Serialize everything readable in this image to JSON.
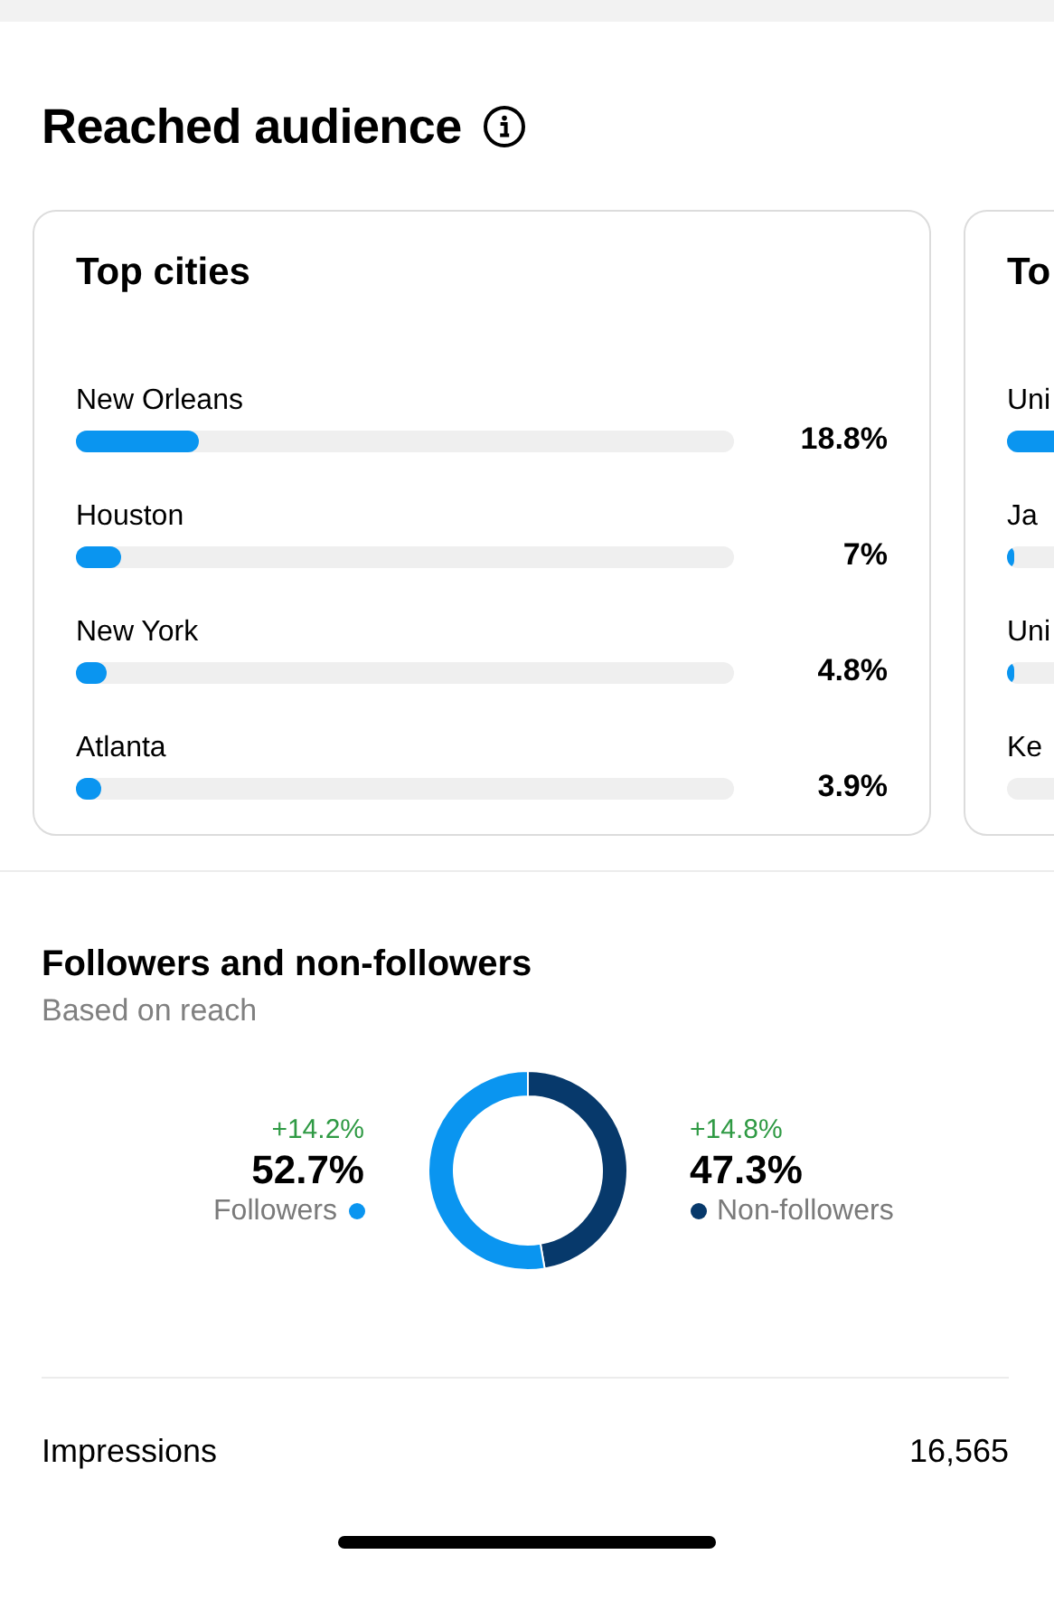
{
  "section": {
    "title": "Reached audience"
  },
  "cards": [
    {
      "title": "Top cities",
      "rows": [
        {
          "label": "New Orleans",
          "level": 0.188,
          "value": "18.8%"
        },
        {
          "label": "Houston",
          "level": 0.07,
          "value": "7%"
        },
        {
          "label": "New York",
          "level": 0.048,
          "value": "4.8%"
        },
        {
          "label": "Atlanta",
          "level": 0.039,
          "value": "3.9%"
        }
      ]
    },
    {
      "title": "To",
      "rows": [
        {
          "label": "Uni",
          "level": 0.6
        },
        {
          "label": "Ja",
          "level": 0.01
        },
        {
          "label": "Uni",
          "level": 0.01
        },
        {
          "label": "Ke"
        }
      ]
    }
  ],
  "followers": {
    "title": "Followers and non-followers",
    "subtitle": "Based on reach",
    "legend": [
      {
        "change": "+14.2%",
        "value": "52.7%",
        "color": "#0a95f0"
      },
      {
        "change": "+14.8%",
        "value": "47.3%",
        "color": "#07396b"
      }
    ],
    "chart_data": {
      "type": "donut",
      "categories": [
        "Followers",
        "Non-followers"
      ],
      "series": [
        {
          "values": [
            52.7,
            47.3
          ]
        }
      ]
    }
  },
  "stats": [
    {
      "label": "Impressions",
      "value": "16,565"
    }
  ]
}
